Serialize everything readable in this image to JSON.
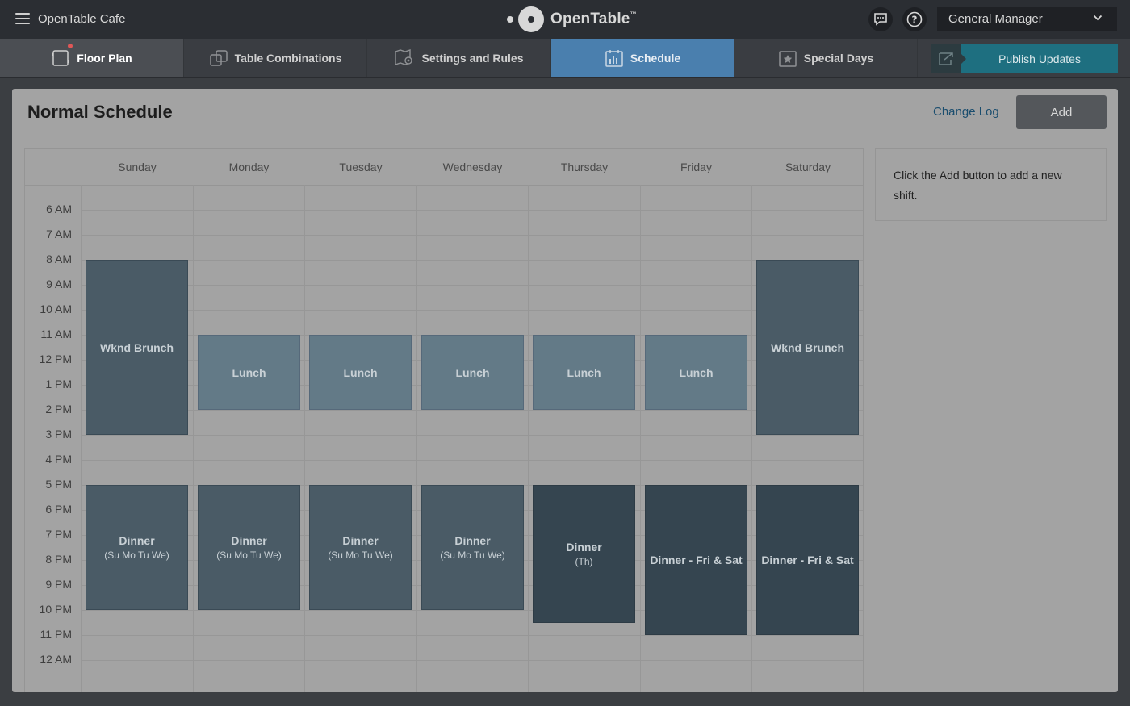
{
  "topbar": {
    "restaurant_name": "OpenTable Cafe",
    "brand": "OpenTable",
    "brand_tm": "™",
    "role": "General Manager",
    "icons": [
      "menu-icon",
      "chat-icon",
      "help-icon",
      "chevron-down-icon"
    ]
  },
  "tabs": [
    {
      "label": "Floor Plan",
      "icon": "floor-plan-icon",
      "notification": true
    },
    {
      "label": "Table Combinations",
      "icon": "table-combinations-icon"
    },
    {
      "label": "Settings and Rules",
      "icon": "settings-rules-icon"
    },
    {
      "label": "Schedule",
      "icon": "schedule-icon",
      "active": true
    },
    {
      "label": "Special Days",
      "icon": "special-days-icon"
    }
  ],
  "publish": {
    "label": "Publish Updates",
    "icon": "publish-icon"
  },
  "page": {
    "title": "Normal Schedule",
    "change_log": "Change Log",
    "add_label": "Add",
    "info_text": "Click the Add button to add a new shift."
  },
  "days": [
    "Sunday",
    "Monday",
    "Tuesday",
    "Wednesday",
    "Thursday",
    "Friday",
    "Saturday"
  ],
  "times": [
    "6 AM",
    "7 AM",
    "8 AM",
    "9 AM",
    "10 AM",
    "11 AM",
    "12 PM",
    "1 PM",
    "2 PM",
    "3 PM",
    "4 PM",
    "5 PM",
    "6 PM",
    "7 PM",
    "8 PM",
    "9 PM",
    "10 PM",
    "11 PM",
    "12 AM"
  ],
  "shifts": [
    {
      "name": "Wknd Brunch",
      "days_label": "",
      "day": 0,
      "start": 8,
      "end": 15,
      "style": "brunch"
    },
    {
      "name": "Wknd Brunch",
      "days_label": "",
      "day": 6,
      "start": 8,
      "end": 15,
      "style": "brunch"
    },
    {
      "name": "Lunch",
      "days_label": "",
      "day": 1,
      "start": 11,
      "end": 14,
      "style": "lunch"
    },
    {
      "name": "Lunch",
      "days_label": "",
      "day": 2,
      "start": 11,
      "end": 14,
      "style": "lunch"
    },
    {
      "name": "Lunch",
      "days_label": "",
      "day": 3,
      "start": 11,
      "end": 14,
      "style": "lunch"
    },
    {
      "name": "Lunch",
      "days_label": "",
      "day": 4,
      "start": 11,
      "end": 14,
      "style": "lunch"
    },
    {
      "name": "Lunch",
      "days_label": "",
      "day": 5,
      "start": 11,
      "end": 14,
      "style": "lunch"
    },
    {
      "name": "Dinner",
      "days_label": "(Su Mo Tu We)",
      "day": 0,
      "start": 17,
      "end": 22,
      "style": "dinner"
    },
    {
      "name": "Dinner",
      "days_label": "(Su Mo Tu We)",
      "day": 1,
      "start": 17,
      "end": 22,
      "style": "dinner"
    },
    {
      "name": "Dinner",
      "days_label": "(Su Mo Tu We)",
      "day": 2,
      "start": 17,
      "end": 22,
      "style": "dinner"
    },
    {
      "name": "Dinner",
      "days_label": "(Su Mo Tu We)",
      "day": 3,
      "start": 17,
      "end": 22,
      "style": "dinner"
    },
    {
      "name": "Dinner",
      "days_label": "(Th)",
      "day": 4,
      "start": 17,
      "end": 22.5,
      "style": "dinner-dark"
    },
    {
      "name": "Dinner - Fri & Sat",
      "days_label": "",
      "day": 5,
      "start": 17,
      "end": 23,
      "style": "dinner-dark"
    },
    {
      "name": "Dinner - Fri & Sat",
      "days_label": "",
      "day": 6,
      "start": 17,
      "end": 23,
      "style": "dinner-dark"
    }
  ]
}
